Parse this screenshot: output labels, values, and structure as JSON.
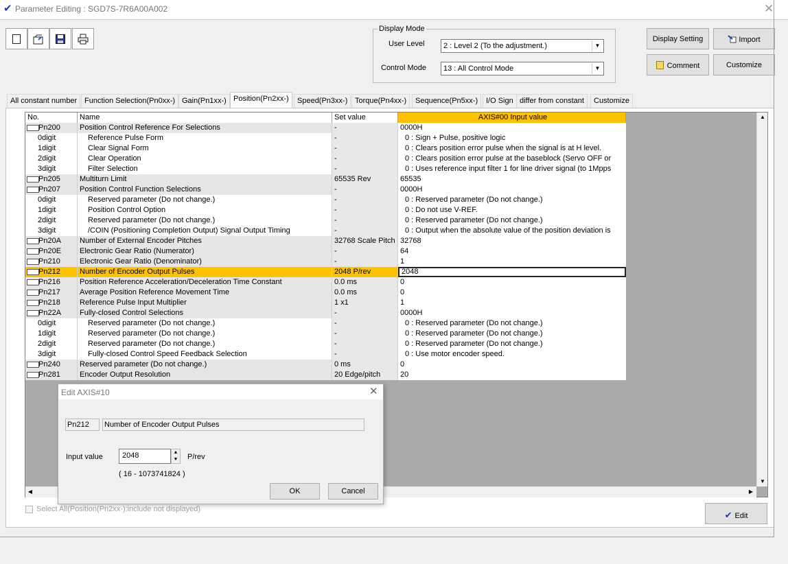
{
  "window": {
    "title": "Parameter Editing : SGD7S-7R6A00A002",
    "close_glyph": "✕"
  },
  "toolbar": {
    "icons": [
      "new-document-icon",
      "open-folder-icon",
      "save-disk-icon",
      "print-icon"
    ]
  },
  "display_mode": {
    "legend": "Display Mode",
    "user_level_label": "User Level",
    "user_level_value": "2 : Level 2 (To the adjustment.)",
    "control_mode_label": "Control Mode",
    "control_mode_value": "13 : All Control Mode"
  },
  "buttons": {
    "display_setting": "Display Setting",
    "import": "Import",
    "comment": "Comment",
    "customize": "Customize",
    "edit": "Edit"
  },
  "tabs": [
    "All constant number",
    "Function Selection(Pn0xx-)",
    "Gain(Pn1xx-)",
    "Position(Pn2xx-)",
    "Speed(Pn3xx-)",
    "Torque(Pn4xx-)",
    "Sequence(Pn5xx-)",
    "I/O Sign",
    "differ from constant",
    "Customize"
  ],
  "active_tab": "Position(Pn2xx-)",
  "grid": {
    "headers": {
      "no": "No.",
      "name": "Name",
      "set": "Set value",
      "value": "AXIS#00 Input value"
    },
    "rows": [
      {
        "no": "Pn200",
        "name": "Position Control Reference For Selections",
        "set": "-",
        "value": "0000H",
        "kind": "param"
      },
      {
        "no": "0digit",
        "name": "Reference Pulse Form",
        "set": "-",
        "value": "0 : Sign + Pulse, positive logic",
        "kind": "digit"
      },
      {
        "no": "1digit",
        "name": "Clear Signal Form",
        "set": "-",
        "value": "0 : Clears position error pulse when the signal is at H level.",
        "kind": "digit"
      },
      {
        "no": "2digit",
        "name": "Clear Operation",
        "set": "-",
        "value": "0 : Clears position error pulse at the baseblock (Servo OFF or",
        "kind": "digit"
      },
      {
        "no": "3digit",
        "name": "Filter Selection",
        "set": "-",
        "value": "0 : Uses reference input filter 1 for line driver signal (to 1Mpps",
        "kind": "digit"
      },
      {
        "no": "Pn205",
        "name": "Multiturn Limit",
        "set": "65535 Rev",
        "value": "65535",
        "kind": "param"
      },
      {
        "no": "Pn207",
        "name": "Position Control Function Selections",
        "set": "-",
        "value": "0000H",
        "kind": "param"
      },
      {
        "no": "0digit",
        "name": "Reserved parameter (Do not change.)",
        "set": "-",
        "value": "0 : Reserved parameter (Do not change.)",
        "kind": "digit"
      },
      {
        "no": "1digit",
        "name": "Position Control Option",
        "set": "-",
        "value": "0 : Do not use V-REF.",
        "kind": "digit"
      },
      {
        "no": "2digit",
        "name": "Reserved parameter (Do not change.)",
        "set": "-",
        "value": "0 : Reserved parameter (Do not change.)",
        "kind": "digit"
      },
      {
        "no": "3digit",
        "name": "/COIN (Positioning Completion Output) Signal Output Timing",
        "set": "-",
        "value": "0 : Output when the absolute value of the position deviation is",
        "kind": "digit"
      },
      {
        "no": "Pn20A",
        "name": "Number of External Encoder Pitches",
        "set": "32768 Scale Pitch",
        "value": "32768",
        "kind": "param"
      },
      {
        "no": "Pn20E",
        "name": "Electronic Gear Ratio (Numerator)",
        "set": "-",
        "value": "64",
        "kind": "param"
      },
      {
        "no": "Pn210",
        "name": "Electronic Gear Ratio (Denominator)",
        "set": "-",
        "value": "1",
        "kind": "param"
      },
      {
        "no": "Pn212",
        "name": "Number of Encoder Output Pulses",
        "set": "2048 P/rev",
        "value": "2048",
        "kind": "param sel"
      },
      {
        "no": "Pn216",
        "name": "Position Reference Acceleration/Deceleration Time Constant",
        "set": "0.0 ms",
        "value": "0",
        "kind": "param"
      },
      {
        "no": "Pn217",
        "name": "Average Position Reference Movement Time",
        "set": "0.0 ms",
        "value": "0",
        "kind": "param"
      },
      {
        "no": "Pn218",
        "name": "Reference Pulse Input Multiplier",
        "set": "1 x1",
        "value": "1",
        "kind": "param"
      },
      {
        "no": "Pn22A",
        "name": "Fully-closed Control Selections",
        "set": "-",
        "value": "0000H",
        "kind": "param"
      },
      {
        "no": "0digit",
        "name": "Reserved parameter (Do not change.)",
        "set": "-",
        "value": "0 : Reserved parameter (Do not change.)",
        "kind": "digit"
      },
      {
        "no": "1digit",
        "name": "Reserved parameter (Do not change.)",
        "set": "-",
        "value": "0 : Reserved parameter (Do not change.)",
        "kind": "digit"
      },
      {
        "no": "2digit",
        "name": "Reserved parameter (Do not change.)",
        "set": "-",
        "value": "0 : Reserved parameter (Do not change.)",
        "kind": "digit"
      },
      {
        "no": "3digit",
        "name": "Fully-closed Control Speed Feedback Selection",
        "set": "-",
        "value": "0 : Use motor encoder speed.",
        "kind": "digit"
      },
      {
        "no": "Pn240",
        "name": "Reserved parameter (Do not change.)",
        "set": "0 ms",
        "value": "0",
        "kind": "param"
      },
      {
        "no": "Pn281",
        "name": "Encoder Output Resolution",
        "set": "20 Edge/pitch",
        "value": "20",
        "kind": "param"
      }
    ]
  },
  "select_all_label": "Select All(Position(Pn2xx-):include not displayed)",
  "dialog": {
    "title": "Edit AXIS#10",
    "param_no": "Pn212",
    "param_name": "Number of Encoder Output Pulses",
    "input_label": "Input value",
    "input_value": "2048",
    "unit": "P/rev",
    "range": "( 16 - 1073741824 )",
    "ok": "OK",
    "cancel": "Cancel"
  },
  "colors": {
    "selection": "#ffc200",
    "header_value": "#ffc200",
    "accent_check": "#1a3db8"
  }
}
